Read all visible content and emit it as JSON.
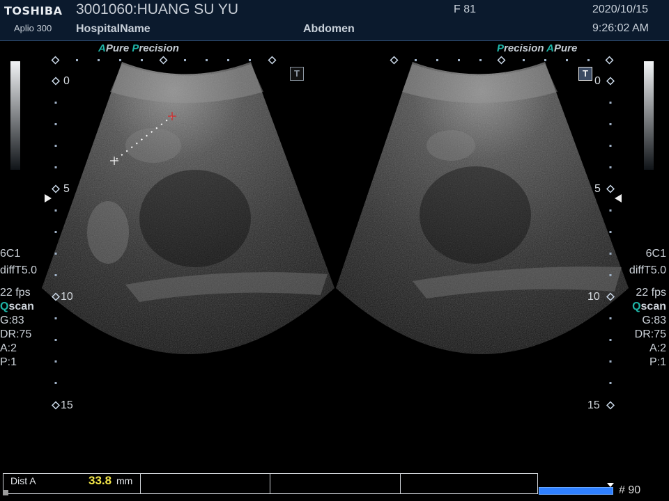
{
  "header": {
    "brand": "TOSHIBA",
    "model": "Aplio 300",
    "patient": "3001060:HUANG SU YU",
    "hospital": "HospitalName",
    "sex_age": "F  81",
    "exam": "Abdomen",
    "date": "2020/10/15",
    "time": "9:26:02 AM"
  },
  "badges": {
    "left": {
      "a": "A",
      "pure": "Pure",
      "p": "P",
      "recision": "recision"
    },
    "right": {
      "p": "P",
      "recision": "recision",
      "a": "A",
      "pure": "Pure"
    }
  },
  "tmarker": "T",
  "depth": {
    "d0": "0",
    "d5": "5",
    "d10": "10",
    "d15": "15"
  },
  "params": {
    "probe": "6C1",
    "preset": "diffT5.0",
    "fps": "22 fps",
    "q": "Q",
    "scan": "scan",
    "gain": "G:83",
    "dr": "DR:75",
    "a": "A:2",
    "p": "P:1"
  },
  "measurement": {
    "label": "Dist A",
    "value": "33.8",
    "unit": "mm"
  },
  "cine": {
    "frame": "# 90"
  },
  "colors": {
    "accent": "#1fb5a8",
    "measure_value": "#f3e649",
    "cine": "#2f80ff"
  }
}
